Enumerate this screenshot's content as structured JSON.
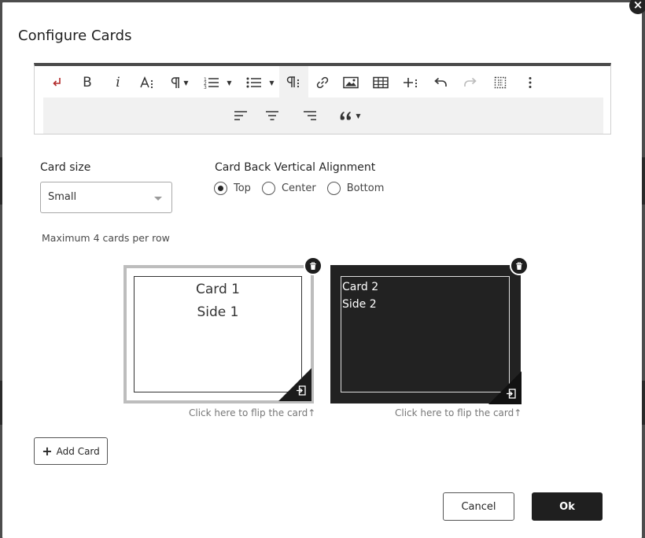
{
  "dialog": {
    "title": "Configure Cards",
    "close_icon": "close-icon"
  },
  "toolbar": {
    "row1": [
      "enter-icon",
      "bold-icon",
      "italic-icon",
      "font-size-icon",
      "paragraph-format-icon",
      "ordered-list-icon",
      "unordered-list-icon",
      "paragraph-style-icon",
      "link-icon",
      "image-icon",
      "table-icon",
      "insert-more-icon",
      "undo-icon",
      "redo-icon",
      "select-all-icon",
      "more-options-icon"
    ],
    "row2": [
      "align-left-icon",
      "align-center-icon",
      "align-right-icon",
      "quote-icon"
    ],
    "bold_label": "B",
    "italic_label": "i"
  },
  "card_size": {
    "label": "Card size",
    "value": "Small",
    "note": "Maximum 4 cards per row"
  },
  "alignment": {
    "label": "Card Back Vertical Alignment",
    "options": [
      {
        "label": "Top",
        "selected": true
      },
      {
        "label": "Center",
        "selected": false
      },
      {
        "label": "Bottom",
        "selected": false
      }
    ]
  },
  "cards": [
    {
      "lines": [
        "Card 1",
        "Side 1"
      ],
      "flip_text": "Click here to flip the card"
    },
    {
      "lines": [
        "Card 2",
        "Side 2"
      ],
      "flip_text": "Click here to flip the card"
    }
  ],
  "buttons": {
    "add_card": "Add Card",
    "cancel": "Cancel",
    "ok": "Ok"
  },
  "colors": {
    "dark": "#222222",
    "accent_red": "#c0392b"
  }
}
